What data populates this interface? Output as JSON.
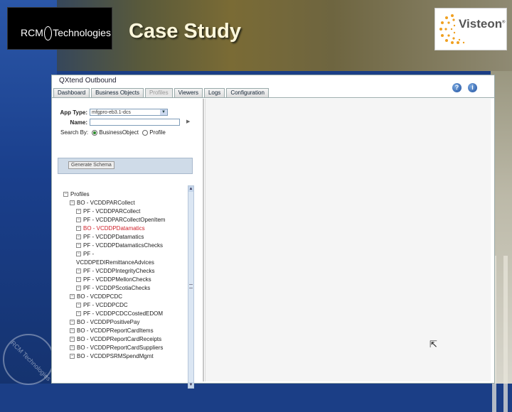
{
  "slide": {
    "title": "Case Study",
    "rcm_logo": {
      "rcm": "RCM",
      "technologies": "Technologies"
    },
    "visteon_logo": "Visteon",
    "watermark": "RCM Technologies"
  },
  "app": {
    "title": "QXtend Outbound",
    "tabs": [
      "Dashboard",
      "Business Objects",
      "Profiles",
      "Viewers",
      "Logs",
      "Configuration"
    ],
    "active_tab": "Profiles",
    "help_icon": "?",
    "info_icon": "i"
  },
  "form": {
    "app_type_label": "App Type:",
    "app_type_value": "mfgpro-eb3.1-dcs",
    "name_label": "Name:",
    "name_value": "",
    "search_by_label": "Search By:",
    "search_options": [
      {
        "label": "BusinessObject",
        "selected": true
      },
      {
        "label": "Profile",
        "selected": false
      }
    ],
    "generate_button": "Generate Schema"
  },
  "tree": {
    "root": "Profiles",
    "items": [
      {
        "text": "BO - VCDDPARCollect",
        "level": 1,
        "icon": "⊟"
      },
      {
        "text": "PF - VCDDPARCollect",
        "level": 2,
        "icon": "⊟"
      },
      {
        "text": "PF - VCDDPARCollectOpenItem",
        "level": 2,
        "icon": "⊟"
      },
      {
        "text": "BO - VCDDPDatamatics",
        "level": 1,
        "icon": "⊟",
        "highlight": true
      },
      {
        "text": "PF - VCDDPDatamatics",
        "level": 2,
        "icon": "⊟"
      },
      {
        "text": "PF - VCDDPDatamaticsChecks",
        "level": 2,
        "icon": "⊟"
      },
      {
        "text": "PF -",
        "level": 2,
        "icon": "⊟"
      },
      {
        "text": "VCDDPEDIRemittanceAdvices",
        "level": 2,
        "icon": ""
      },
      {
        "text": "PF - VCDDPIntegrityChecks",
        "level": 2,
        "icon": "⊟"
      },
      {
        "text": "PF - VCDDPMellonChecks",
        "level": 2,
        "icon": "⊟"
      },
      {
        "text": "PF - VCDDPScotiaChecks",
        "level": 2,
        "icon": "⊟"
      },
      {
        "text": "BO - VCDDPCDC",
        "level": 1,
        "icon": "⊟"
      },
      {
        "text": "PF - VCDDPCDC",
        "level": 2,
        "icon": "⊟"
      },
      {
        "text": "PF - VCDDPCDCCostedEDOM",
        "level": 2,
        "icon": "⊟"
      },
      {
        "text": "BO - VCDDPPositivePay",
        "level": 1,
        "icon": "⊟"
      },
      {
        "text": "BO - VCDDPReportCardItems",
        "level": 1,
        "icon": "⊟"
      },
      {
        "text": "BO - VCDDPReportCardReceipts",
        "level": 1,
        "icon": "⊟"
      },
      {
        "text": "BO - VCDDPReportCardSuppliers",
        "level": 1,
        "icon": "⊟"
      },
      {
        "text": "BO - VCDDPSRMSpendMgmt",
        "level": 1,
        "icon": "⊟"
      }
    ]
  },
  "colors": {
    "highlight": "#d0202a",
    "panel": "#cfdbe8",
    "title": "#fff8dc"
  }
}
